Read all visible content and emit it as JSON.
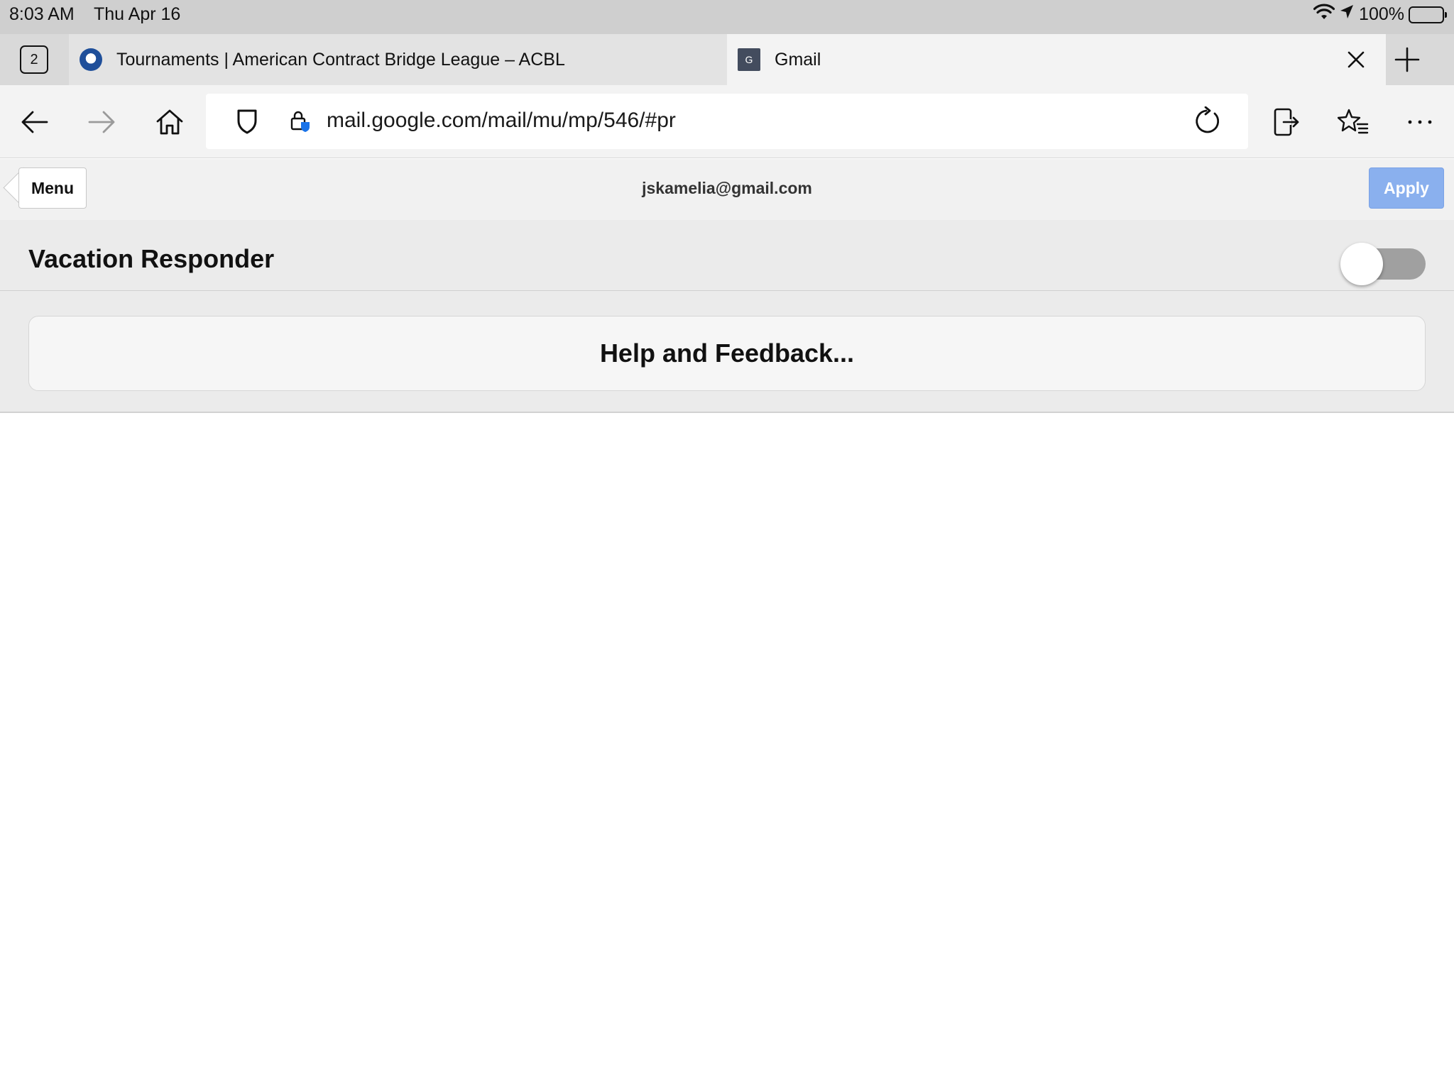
{
  "status_bar": {
    "time": "8:03 AM",
    "date": "Thu Apr 16",
    "battery": "100%"
  },
  "tabs": {
    "count": "2",
    "items": [
      {
        "title": "Tournaments | American Contract Bridge League – ACBL",
        "favicon": "acbl-logo-icon"
      },
      {
        "title": "Gmail",
        "favicon_letter": "G"
      }
    ]
  },
  "toolbar": {
    "url": "mail.google.com/mail/mu/mp/546/#pr"
  },
  "gmail_header": {
    "menu_label": "Menu",
    "account": "jskamelia@gmail.com",
    "apply_label": "Apply"
  },
  "settings": {
    "vacation_label": "Vacation Responder",
    "vacation_enabled": false,
    "help_label": "Help and Feedback..."
  },
  "colors": {
    "apply_button": "#8ab0ee",
    "toggle_off": "#a0a0a0"
  }
}
